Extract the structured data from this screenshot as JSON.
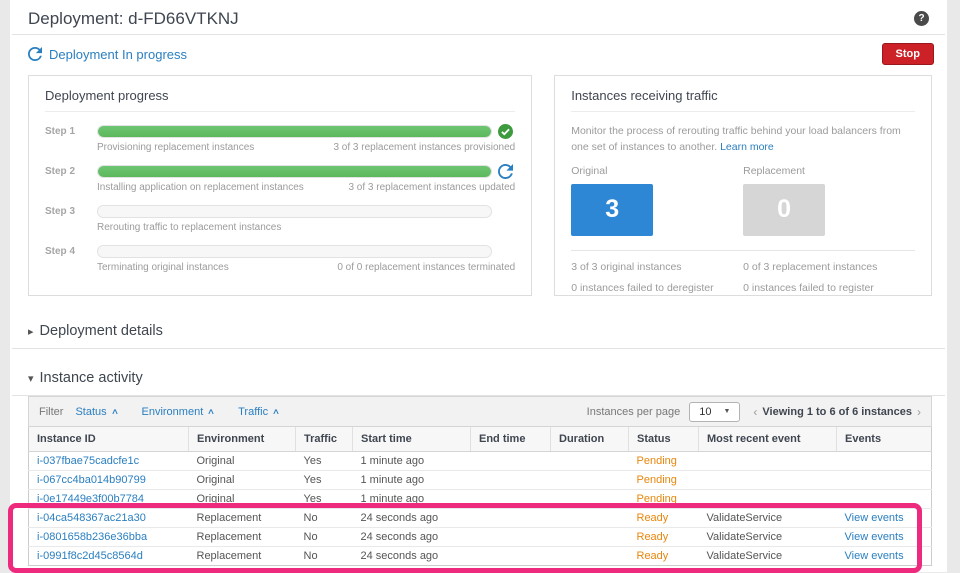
{
  "page": {
    "title": "Deployment: d-FD66VTKNJ",
    "status_label": "Deployment In progress",
    "stop_button": "Stop",
    "help_icon": "question-mark-icon"
  },
  "deployment_progress": {
    "title": "Deployment progress",
    "steps": [
      {
        "label": "Step 1",
        "progress": 100,
        "state": "complete",
        "description": "Provisioning replacement instances",
        "detail": "3 of 3 replacement instances provisioned"
      },
      {
        "label": "Step 2",
        "progress": 100,
        "state": "in-progress",
        "description": "Installing application on replacement instances",
        "detail": "3 of 3 replacement instances updated"
      },
      {
        "label": "Step 3",
        "progress": 0,
        "state": "pending",
        "description": "Rerouting traffic to replacement instances",
        "detail": ""
      },
      {
        "label": "Step 4",
        "progress": 0,
        "state": "pending",
        "description": "Terminating original instances",
        "detail": "0 of 0 replacement instances terminated"
      }
    ]
  },
  "traffic_panel": {
    "title": "Instances receiving traffic",
    "description": "Monitor the process of rerouting traffic behind your load balancers from one set of instances to another.",
    "learn_more": "Learn more",
    "original": {
      "label": "Original",
      "count": "3",
      "stat1": "3 of 3 original instances",
      "stat2": "0 instances failed to deregister"
    },
    "replacement": {
      "label": "Replacement",
      "count": "0",
      "stat1": "0 of 3 replacement instances",
      "stat2": "0 instances failed to register"
    }
  },
  "sections": {
    "deployment_details": "Deployment details",
    "instance_activity": "Instance activity"
  },
  "filter_bar": {
    "filter_label": "Filter",
    "filters": [
      "Status",
      "Environment",
      "Traffic"
    ],
    "per_page_label": "Instances per page",
    "per_page_value": "10",
    "paging": "Viewing 1 to 6 of 6 instances"
  },
  "table": {
    "columns": [
      "Instance ID",
      "Environment",
      "Traffic",
      "Start time",
      "End time",
      "Duration",
      "Status",
      "Most recent event",
      "Events"
    ],
    "rows": [
      {
        "instance_id": "i-037fbae75cadcfe1c",
        "environment": "Original",
        "traffic": "Yes",
        "start_time": "1 minute ago",
        "end_time": "",
        "duration": "",
        "status": "Pending",
        "recent_event": "",
        "events": ""
      },
      {
        "instance_id": "i-067cc4ba014b90799",
        "environment": "Original",
        "traffic": "Yes",
        "start_time": "1 minute ago",
        "end_time": "",
        "duration": "",
        "status": "Pending",
        "recent_event": "",
        "events": ""
      },
      {
        "instance_id": "i-0e17449e3f00b7784",
        "environment": "Original",
        "traffic": "Yes",
        "start_time": "1 minute ago",
        "end_time": "",
        "duration": "",
        "status": "Pending",
        "recent_event": "",
        "events": ""
      },
      {
        "instance_id": "i-04ca548367ac21a30",
        "environment": "Replacement",
        "traffic": "No",
        "start_time": "24 seconds ago",
        "end_time": "",
        "duration": "",
        "status": "Ready",
        "recent_event": "ValidateService",
        "events": "View events"
      },
      {
        "instance_id": "i-0801658b236e36bba",
        "environment": "Replacement",
        "traffic": "No",
        "start_time": "24 seconds ago",
        "end_time": "",
        "duration": "",
        "status": "Ready",
        "recent_event": "ValidateService",
        "events": "View events"
      },
      {
        "instance_id": "i-0991f8c2d45c8564d",
        "environment": "Replacement",
        "traffic": "No",
        "start_time": "24 seconds ago",
        "end_time": "",
        "duration": "",
        "status": "Ready",
        "recent_event": "ValidateService",
        "events": "View events"
      }
    ]
  },
  "colors": {
    "link_blue": "#2a7fc0",
    "green": "#5cb85c",
    "status_orange": "#e8860b",
    "stop_red": "#cb2127",
    "highlight_pink": "#ed2a7d",
    "count_blue": "#2e87d5",
    "count_gray": "#d6d6d6"
  }
}
